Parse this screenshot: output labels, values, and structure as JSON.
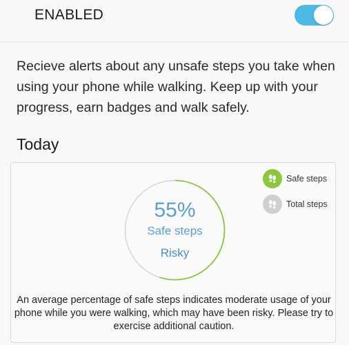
{
  "header": {
    "status_label": "ENABLED",
    "toggle_on": true,
    "toggle_color": "#4fb9e6"
  },
  "description": "Recieve alerts about any unsafe steps you take when using your phone while walking. Keep up with your progress, earn badges and walk safely.",
  "today": {
    "title": "Today",
    "legend": [
      {
        "label": "Safe steps",
        "icon": "footsteps-icon",
        "color": "#8cc63f"
      },
      {
        "label": "Total steps",
        "icon": "footsteps-icon",
        "color": "#cfcfcf"
      }
    ],
    "safe_percent": 55,
    "percent_text": "55%",
    "metric_label": "Safe steps",
    "status": "Risky",
    "ring_color": "#8cc63f",
    "accent_color": "#5b9fd1",
    "note": "An average percentage of safe steps indicates moderate usage of your phone while you were walking, which may have been risky. Please try to exercise additional caution."
  }
}
